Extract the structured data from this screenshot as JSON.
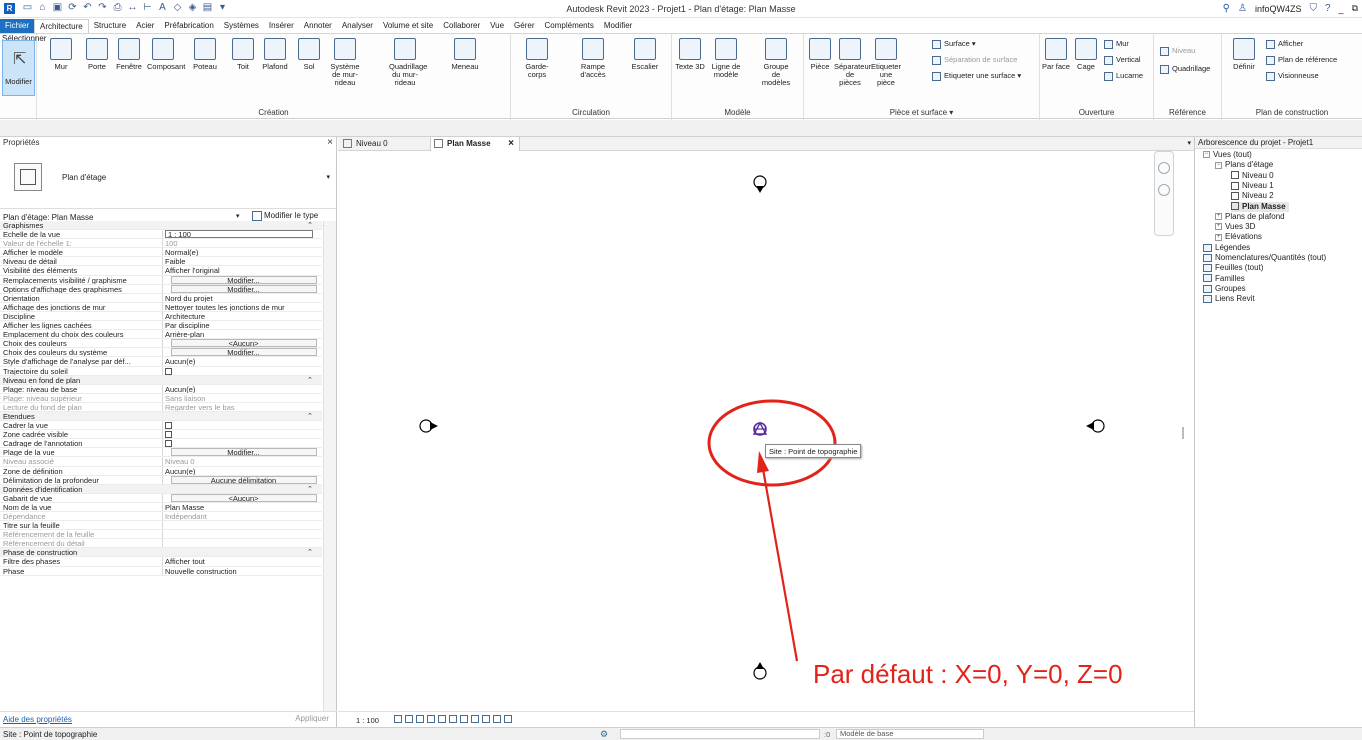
{
  "titlebar": {
    "title": "Autodesk Revit 2023 - Projet1 - Plan d'étage: Plan Masse",
    "user": "infoQW4ZS"
  },
  "tabs": [
    "Fichier",
    "Architecture",
    "Structure",
    "Acier",
    "Préfabrication",
    "Systèmes",
    "Insérer",
    "Annoter",
    "Analyser",
    "Volume et site",
    "Collaborer",
    "Vue",
    "Gérer",
    "Compléments",
    "Modifier"
  ],
  "ribbon": {
    "select": {
      "modify": "Modifier",
      "label": "Sélectionner ▾"
    },
    "creation": {
      "label": "Création",
      "buttons": [
        "Mur",
        "Porte",
        "Fenêtre",
        "Composant",
        "Poteau",
        "Toit",
        "Plafond",
        "Sol",
        "Système de mur-rideau",
        "Quadrillage du mur-rideau",
        "Meneau"
      ]
    },
    "circulation": {
      "label": "Circulation",
      "buttons": [
        "Garde-corps",
        "Rampe d'accès",
        "Escalier"
      ]
    },
    "modele": {
      "label": "Modèle",
      "buttons": [
        "Texte 3D",
        "Ligne de modèle",
        "Groupe de modèles"
      ]
    },
    "piece": {
      "label": "Pièce et surface ▾",
      "buttons": [
        "Pièce",
        "Séparateur de pièces",
        "Etiqueter une pièce"
      ],
      "small": [
        "Surface ▾",
        "Séparation de surface",
        "Etiqueter une surface ▾"
      ]
    },
    "ouverture": {
      "label": "Ouverture",
      "buttons": [
        "Par face",
        "Cage"
      ],
      "small": [
        "Mur",
        "Vertical",
        "Lucarne"
      ]
    },
    "reference": {
      "label": "Référence",
      "small": [
        "Niveau",
        "Quadrillage"
      ]
    },
    "plan": {
      "label": "Plan de construction",
      "button": "Définir",
      "small": [
        "Afficher",
        "Plan de référence",
        "Visionneuse"
      ]
    }
  },
  "properties": {
    "title": "Propriétés",
    "type_name": "Plan d'étage",
    "filter": "Plan d'étage: Plan Masse",
    "edit_type": "Modifier le type",
    "rows": [
      {
        "k": "Graphismes",
        "t": "sect"
      },
      {
        "k": "Echelle de la vue",
        "v": "1 : 100",
        "t": "input"
      },
      {
        "k": "Valeur de l'échelle    1:",
        "v": "100",
        "t": "dim"
      },
      {
        "k": "Afficher le modèle",
        "v": "Normal(e)"
      },
      {
        "k": "Niveau de détail",
        "v": "Faible"
      },
      {
        "k": "Visibilité des éléments",
        "v": "Afficher l'original"
      },
      {
        "k": "Remplacements visibilité / graphisme",
        "v": "Modifier...",
        "t": "btn"
      },
      {
        "k": "Options d'affichage des graphismes",
        "v": "Modifier...",
        "t": "btn"
      },
      {
        "k": "Orientation",
        "v": "Nord du projet"
      },
      {
        "k": "Affichage des jonctions de mur",
        "v": "Nettoyer toutes les jonctions de mur"
      },
      {
        "k": "Discipline",
        "v": "Architecture"
      },
      {
        "k": "Afficher les lignes cachées",
        "v": "Par discipline"
      },
      {
        "k": "Emplacement du choix des couleurs",
        "v": "Arrière-plan"
      },
      {
        "k": "Choix des couleurs",
        "v": "<Aucun>",
        "t": "btn"
      },
      {
        "k": "Choix des couleurs du système",
        "v": "Modifier...",
        "t": "btn"
      },
      {
        "k": "Style d'affichage de l'analyse par déf...",
        "v": "Aucun(e)"
      },
      {
        "k": "Trajectoire du soleil",
        "v": "",
        "t": "cb"
      },
      {
        "k": "Niveau en fond de plan",
        "t": "sect"
      },
      {
        "k": "Plage: niveau de base",
        "v": "Aucun(e)"
      },
      {
        "k": "Plage: niveau supérieur",
        "v": "Sans liaison",
        "t": "dim"
      },
      {
        "k": "Lecture du fond de plan",
        "v": "Regarder vers le bas",
        "t": "dim"
      },
      {
        "k": "Etendues",
        "t": "sect"
      },
      {
        "k": "Cadrer la vue",
        "v": "",
        "t": "cb"
      },
      {
        "k": "Zone cadrée visible",
        "v": "",
        "t": "cb"
      },
      {
        "k": "Cadrage de l'annotation",
        "v": "",
        "t": "cb"
      },
      {
        "k": "Plage de la vue",
        "v": "Modifier...",
        "t": "btn"
      },
      {
        "k": "Niveau associé",
        "v": "Niveau 0",
        "t": "dim"
      },
      {
        "k": "Zone de définition",
        "v": "Aucun(e)"
      },
      {
        "k": "Délimitation de la profondeur",
        "v": "Aucune délimitation",
        "t": "btn"
      },
      {
        "k": "Données d'identification",
        "t": "sect"
      },
      {
        "k": "Gabarit de vue",
        "v": "<Aucun>",
        "t": "btn"
      },
      {
        "k": "Nom de la vue",
        "v": "Plan Masse"
      },
      {
        "k": "Dépendance",
        "v": "Indépendant",
        "t": "dim"
      },
      {
        "k": "Titre sur la feuille",
        "v": ""
      },
      {
        "k": "Référencement de la feuille",
        "v": "",
        "t": "dim"
      },
      {
        "k": "Référencement du détail",
        "v": "",
        "t": "dim"
      },
      {
        "k": "Phase de construction",
        "t": "sect"
      },
      {
        "k": "Filtre des phases",
        "v": "Afficher tout"
      },
      {
        "k": "Phase",
        "v": "Nouvelle construction"
      }
    ],
    "help_link": "Aide des propriétés",
    "apply": "Appliquer"
  },
  "view_tabs": [
    {
      "label": "Niveau 0"
    },
    {
      "label": "Plan Masse"
    }
  ],
  "canvas": {
    "tooltip": "Site : Point de topographie",
    "annotation": "Par défaut : X=0, Y=0, Z=0",
    "annotation_color": "#e2231a",
    "scale": "1 : 100"
  },
  "browser": {
    "title": "Arborescence du projet - Projet1",
    "nodes": [
      {
        "label": "Vues (tout)",
        "level": 0,
        "icon": "views"
      },
      {
        "label": "Plans d'étage",
        "level": 1,
        "icon": "toggle-open"
      },
      {
        "label": "Niveau 0",
        "level": 2,
        "icon": "leaf"
      },
      {
        "label": "Niveau 1",
        "level": 2,
        "icon": "leaf"
      },
      {
        "label": "Niveau 2",
        "level": 2,
        "icon": "leaf"
      },
      {
        "label": "Plan Masse",
        "level": 2,
        "icon": "leaf",
        "selected": true
      },
      {
        "label": "Plans de plafond",
        "level": 1,
        "icon": "toggle"
      },
      {
        "label": "Vues 3D",
        "level": 1,
        "icon": "toggle"
      },
      {
        "label": "Elévations",
        "level": 1,
        "icon": "toggle"
      },
      {
        "label": "Légendes",
        "level": 0,
        "icon": "folder"
      },
      {
        "label": "Nomenclatures/Quantités (tout)",
        "level": 0,
        "icon": "folder-toggle"
      },
      {
        "label": "Feuilles (tout)",
        "level": 0,
        "icon": "folder"
      },
      {
        "label": "Familles",
        "level": 0,
        "icon": "folder-toggle"
      },
      {
        "label": "Groupes",
        "level": 0,
        "icon": "folder-toggle"
      },
      {
        "label": "Liens Revit",
        "level": 0,
        "icon": "link"
      }
    ]
  },
  "status": {
    "text": "Site : Point de topographie",
    "zero": ":0",
    "model": "Modèle de base"
  }
}
